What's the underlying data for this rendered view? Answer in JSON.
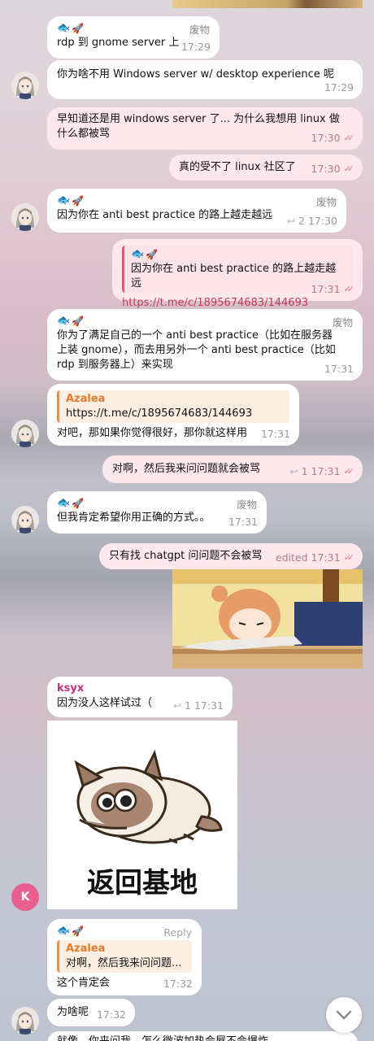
{
  "chat": {
    "messages": [
      {
        "tag": "废物",
        "text": "rdp 到 gnome server 上",
        "time": "17:29"
      },
      {
        "text": "你为啥不用 Windows server w/ desktop experience 呢",
        "time": "17:29"
      },
      {
        "text": "早知道还是用 windows server 了... 为什么我想用 linux 做什么都被骂",
        "time": "17:30"
      },
      {
        "text": "真的受不了 linux 社区了",
        "time": "17:30"
      },
      {
        "tag": "废物",
        "text": "因为你在 anti best practice 的路上越走越远",
        "reply_count": "2",
        "time": "17:30"
      },
      {
        "quote_text": "因为你在 anti best practice 的路上越走越远",
        "link": "https://t.me/c/1895674683/144693",
        "time": "17:31"
      },
      {
        "tag": "废物",
        "text": "你为了满足自己的一个 anti best practice（比如在服务器上装 gnome），而去用另外一个 anti best practice（比如 rdp 到服务器上）来实现",
        "time": "17:31"
      },
      {
        "quote_name": "Azalea",
        "quote_text": "https://t.me/c/1895674683/144693",
        "text": "对吧，那如果你觉得很好，那你就这样用",
        "time": "17:31"
      },
      {
        "text": "对啊，然后我来问问题就会被骂",
        "reply_count": "1",
        "time": "17:31"
      },
      {
        "tag": "废物",
        "text": "但我肯定希望你用正确的方式。。",
        "time": "17:31"
      },
      {
        "text": "只有找 chatgpt 问问题不会被骂",
        "edited": "edited",
        "time": "17:31"
      },
      {
        "sender": "ksyx",
        "text": "因为没人这样试过（",
        "reply_count": "1",
        "time": "17:31"
      },
      {
        "sticker_caption": "返回基地"
      },
      {
        "tag": "Reply",
        "quote_name": "Azalea",
        "quote_text": "对啊，然后我来问问题...",
        "text": "这个肯定会",
        "time": "17:32"
      },
      {
        "text": "为啥呢",
        "time": "17:32"
      },
      {
        "text": "就像，你来问我，怎么微波加热会屋不会爆炸"
      }
    ]
  },
  "avatar_k_letter": "K",
  "colors": {
    "outgoing_bubble": "#fde8ee",
    "incoming_bubble": "#ffffff",
    "link": "#c23a5b",
    "check": "#d67a92",
    "quote_bar": "#e39245"
  }
}
